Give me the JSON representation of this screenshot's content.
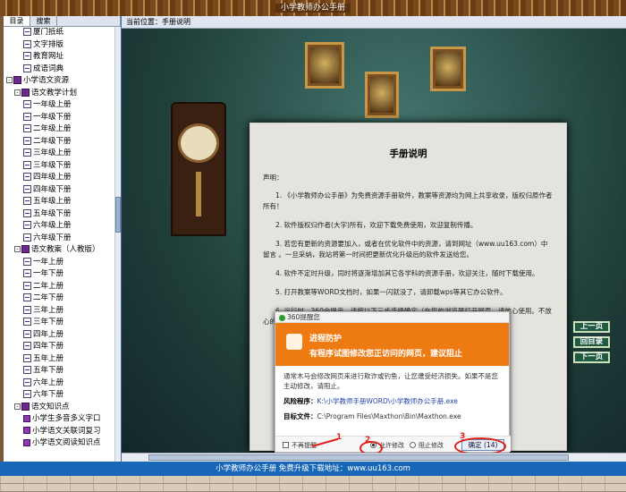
{
  "window": {
    "title": "小学教师办公手册"
  },
  "sidebar": {
    "tabs": [
      {
        "label": "目录"
      },
      {
        "label": "搜索"
      }
    ],
    "items": [
      {
        "label": "厦门抵纸",
        "level": 2,
        "icon": "doc-icon"
      },
      {
        "label": "文字排版",
        "level": 2,
        "icon": "doc-icon"
      },
      {
        "label": "教育网址",
        "level": 2,
        "icon": "doc-icon"
      },
      {
        "label": "成语词典",
        "level": 2,
        "icon": "doc-icon"
      },
      {
        "label": "小学语文资源",
        "level": 0,
        "icon": "book-icon",
        "toggle": "-"
      },
      {
        "label": "语文教学计划",
        "level": 1,
        "icon": "book-icon",
        "toggle": "-"
      },
      {
        "label": "一年级上册",
        "level": 2,
        "icon": "doc-icon"
      },
      {
        "label": "一年级下册",
        "level": 2,
        "icon": "doc-icon"
      },
      {
        "label": "二年级上册",
        "level": 2,
        "icon": "doc-icon"
      },
      {
        "label": "二年级下册",
        "level": 2,
        "icon": "doc-icon"
      },
      {
        "label": "三年级上册",
        "level": 2,
        "icon": "doc-icon"
      },
      {
        "label": "三年级下册",
        "level": 2,
        "icon": "doc-icon"
      },
      {
        "label": "四年级上册",
        "level": 2,
        "icon": "doc-icon"
      },
      {
        "label": "四年级下册",
        "level": 2,
        "icon": "doc-icon"
      },
      {
        "label": "五年级上册",
        "level": 2,
        "icon": "doc-icon"
      },
      {
        "label": "五年级下册",
        "level": 2,
        "icon": "doc-icon"
      },
      {
        "label": "六年级上册",
        "level": 2,
        "icon": "doc-icon"
      },
      {
        "label": "六年级下册",
        "level": 2,
        "icon": "doc-icon"
      },
      {
        "label": "语文教案（人教版）",
        "level": 1,
        "icon": "book-icon",
        "toggle": "-"
      },
      {
        "label": "一年上册",
        "level": 2,
        "icon": "doc-icon"
      },
      {
        "label": "一年下册",
        "level": 2,
        "icon": "doc-icon"
      },
      {
        "label": "二年上册",
        "level": 2,
        "icon": "doc-icon"
      },
      {
        "label": "二年下册",
        "level": 2,
        "icon": "doc-icon"
      },
      {
        "label": "三年上册",
        "level": 2,
        "icon": "doc-icon"
      },
      {
        "label": "三年下册",
        "level": 2,
        "icon": "doc-icon"
      },
      {
        "label": "四年上册",
        "level": 2,
        "icon": "doc-icon"
      },
      {
        "label": "四年下册",
        "level": 2,
        "icon": "doc-icon"
      },
      {
        "label": "五年上册",
        "level": 2,
        "icon": "doc-icon"
      },
      {
        "label": "五年下册",
        "level": 2,
        "icon": "doc-icon"
      },
      {
        "label": "六年上册",
        "level": 2,
        "icon": "doc-icon"
      },
      {
        "label": "六年下册",
        "level": 2,
        "icon": "doc-icon"
      },
      {
        "label": "语文知识点",
        "level": 1,
        "icon": "book-icon",
        "toggle": "-"
      },
      {
        "label": "小学生多音多义字口",
        "level": 2,
        "icon": "book-small-icon"
      },
      {
        "label": "小学语文关联词复习",
        "level": 2,
        "icon": "book-small-icon"
      },
      {
        "label": "小学语文阅读知识点",
        "level": 2,
        "icon": "book-small-icon"
      }
    ]
  },
  "location": {
    "label": "当前位置：",
    "value": "手册说明"
  },
  "document": {
    "title": "手册说明",
    "intro": "声明：",
    "paragraphs": [
      "1. 《小学教师办公手册》为免费资源手册软件，教案等资源均为网上共享收录，版权归原作者所有！",
      "2. 软件版权归作者(大宇)所有，欢迎下载免费使用，欢迎复制传播。",
      "3. 若您有更新的资源要加入，或者在优化软件中的资源，请到网址（www.uu163.com）中留言 。一旦采纳，我站将第一时间把更新优化升级后的软件发送给您。",
      "4. 软件不定时升级，同时将逐渐增加其它各学科的资源手册，欢迎关注，随时下载使用。",
      "5. 打开教案等WORD文档时，如果一闪就没了，请卸载wps等其它办公软件。",
      "6. 运行时，360会提示，请按以下三步选择确定（在您的浏览器打开网页，请放心使用。不放心的请勿使用。）。"
    ]
  },
  "nav_buttons": {
    "prev": "上一页",
    "home": "回目录",
    "next": "下一页"
  },
  "dialog": {
    "brand": "360提醒您",
    "heading": "进程防护",
    "subheading": "有程序试图修改您正访问的网页，建议阻止",
    "description": "通常木马会修改网页来进行欺诈或钓鱼，让您遭受经济损失。如果不是您主动修改，请阻止。",
    "risk_label": "风险程序：",
    "risk_value": "K:\\小学教师手册WORD\\小学教师办公手册.exe",
    "target_label": "目标文件：",
    "target_value": "C:\\Program Files\\Maxthon\\Bin\\Maxthon.exe",
    "option1": "不再提醒",
    "option2": "允许修改",
    "option3": "阻止修改",
    "ok_label": "确定 (14)",
    "annotations": [
      "1",
      "2",
      "3"
    ]
  },
  "statusbar": {
    "text": "小学教师办公手册  免费升级下载地址：www.uu163.com"
  },
  "colors": {
    "accent_orange": "#ee7a12",
    "status_blue": "#1866b8",
    "annotation_red": "#e0201a"
  }
}
